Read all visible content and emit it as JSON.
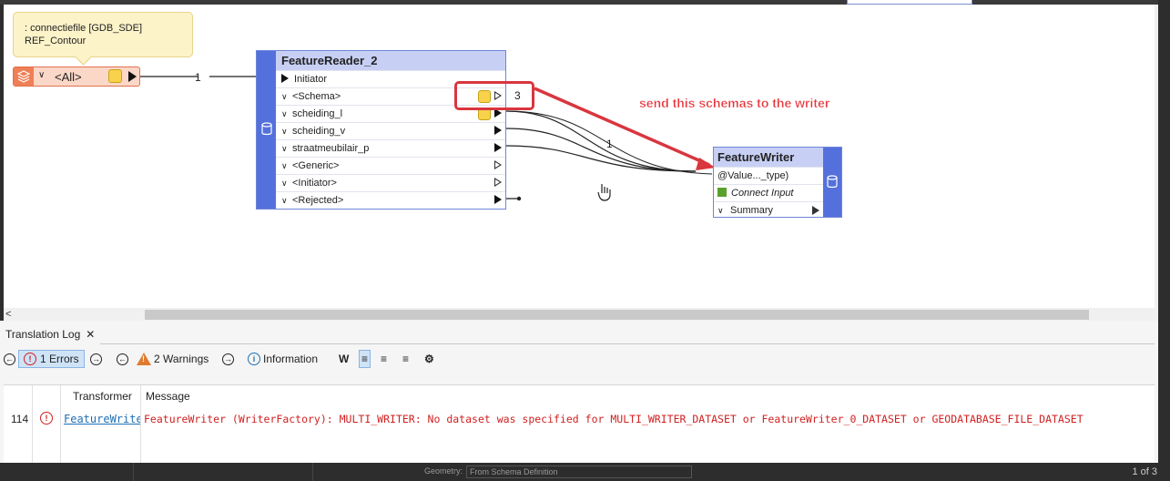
{
  "annotation": {
    "line1": ": connectiefile [GDB_SDE]",
    "line2": "REF_Contour"
  },
  "creator": {
    "label": "<All>"
  },
  "connections": {
    "creator_to_reader": "1",
    "schema_count": "3",
    "to_writer": "1"
  },
  "reader": {
    "title": "FeatureReader_2",
    "input": "Initiator",
    "ports": [
      "<Schema>",
      "scheiding_l",
      "scheiding_v",
      "straatmeubilair_p",
      "<Generic>",
      "<Initiator>",
      "<Rejected>"
    ]
  },
  "writer": {
    "title": "FeatureWriter",
    "input": "@Value..._type)",
    "connect": "Connect Input",
    "summary": "Summary"
  },
  "callout": {
    "text": "send this schemas to the writer",
    "color": "#e8343c"
  },
  "log_panel": {
    "tab": "Translation Log",
    "errors": "1 Errors",
    "warnings": "2 Warnings",
    "information": "Information",
    "columns": {
      "transformer": "Transformer",
      "message": "Message"
    },
    "rows": [
      {
        "line": "114",
        "transformer": "FeatureWriter",
        "message": "FeatureWriter (WriterFactory): MULTI_WRITER: No dataset was specified for MULTI_WRITER_DATASET or FeatureWriter_0_DATASET or GEODATABASE_FILE_DATASET"
      }
    ]
  },
  "statusbar": {
    "geometry_label": "Geometry:",
    "geometry_value": "From Schema Definition",
    "page": "1 of 3"
  },
  "colors": {
    "reader_side": "#5470dc",
    "title_bg": "#c7d0f4",
    "creator": "#ef7f55",
    "error": "#d02020"
  }
}
